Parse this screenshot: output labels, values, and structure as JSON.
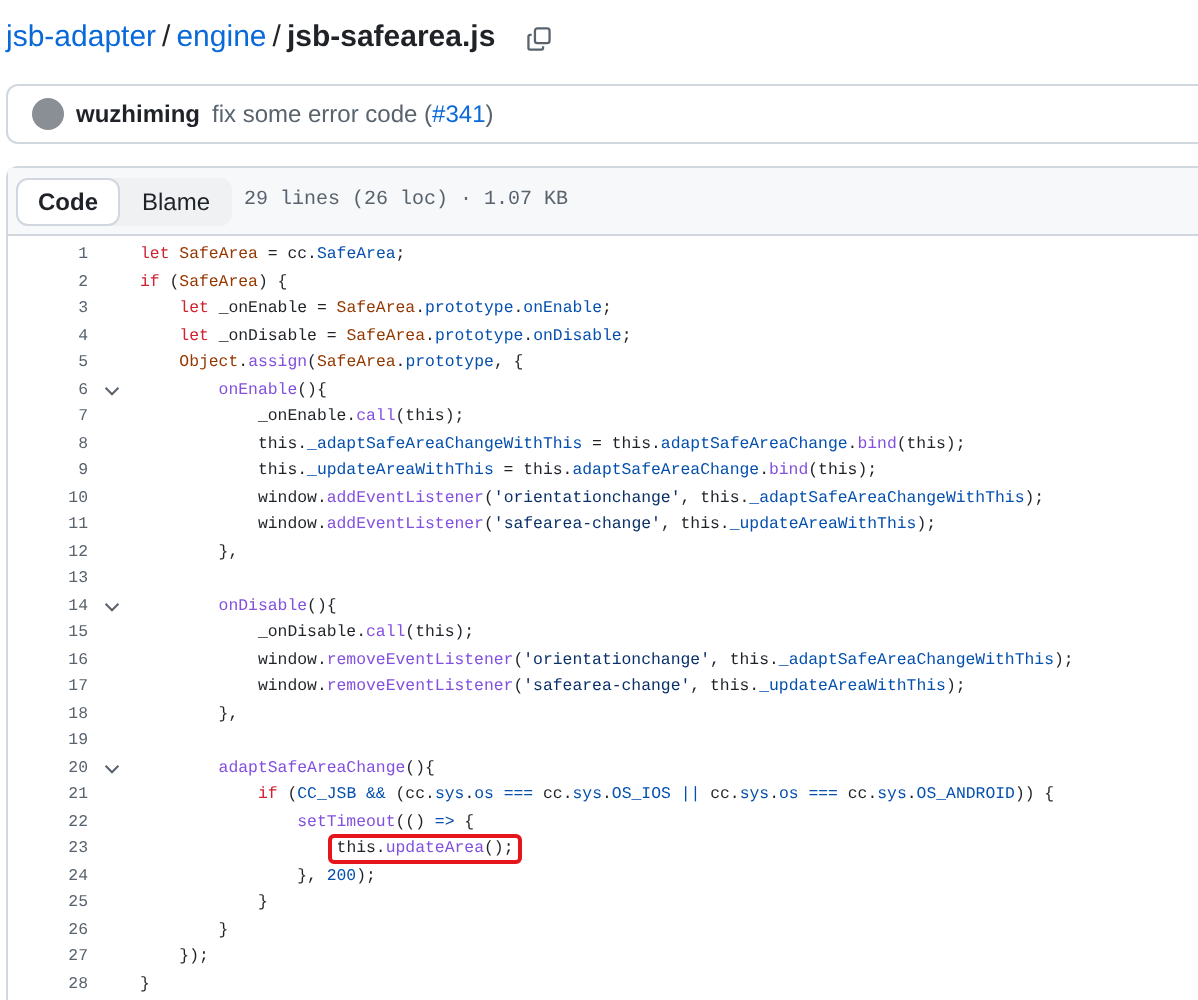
{
  "breadcrumb": {
    "links": [
      "jsb-adapter",
      "engine"
    ],
    "separator": "/",
    "current": "jsb-safearea.js"
  },
  "commit": {
    "author": "wuzhiming",
    "message": "fix some error code (",
    "pr": "#341",
    "message_end": ")"
  },
  "file_header": {
    "tabs": [
      {
        "label": "Code",
        "selected": true
      },
      {
        "label": "Blame",
        "selected": false
      }
    ],
    "info": "29 lines (26 loc) · 1.07 KB"
  },
  "code": {
    "lines": [
      {
        "number": "1",
        "foldable": false,
        "highlight": false,
        "tokens": [
          {
            "text": "let",
            "kind": "keyword"
          },
          {
            "text": " SafeArea",
            "kind": "variable"
          },
          {
            "text": " = cc.",
            "kind": "plain"
          },
          {
            "text": "SafeArea",
            "kind": "property"
          },
          {
            "text": ";",
            "kind": "plain"
          }
        ]
      },
      {
        "number": "2",
        "foldable": false,
        "highlight": false,
        "tokens": [
          {
            "text": "if",
            "kind": "keyword"
          },
          {
            "text": " (",
            "kind": "plain"
          },
          {
            "text": "SafeArea",
            "kind": "variable"
          },
          {
            "text": ") {",
            "kind": "plain"
          }
        ]
      },
      {
        "number": "3",
        "foldable": false,
        "highlight": false,
        "tokens": [
          {
            "text": "    let",
            "kind": "keyword"
          },
          {
            "text": " _onEnable = ",
            "kind": "plain"
          },
          {
            "text": "SafeArea",
            "kind": "variable"
          },
          {
            "text": ".",
            "kind": "plain"
          },
          {
            "text": "prototype",
            "kind": "property"
          },
          {
            "text": ".",
            "kind": "plain"
          },
          {
            "text": "onEnable",
            "kind": "property"
          },
          {
            "text": ";",
            "kind": "plain"
          }
        ]
      },
      {
        "number": "4",
        "foldable": false,
        "highlight": false,
        "tokens": [
          {
            "text": "    let",
            "kind": "keyword"
          },
          {
            "text": " _onDisable = ",
            "kind": "plain"
          },
          {
            "text": "SafeArea",
            "kind": "variable"
          },
          {
            "text": ".",
            "kind": "plain"
          },
          {
            "text": "prototype",
            "kind": "property"
          },
          {
            "text": ".",
            "kind": "plain"
          },
          {
            "text": "onDisable",
            "kind": "property"
          },
          {
            "text": ";",
            "kind": "plain"
          }
        ]
      },
      {
        "number": "5",
        "foldable": false,
        "highlight": false,
        "tokens": [
          {
            "text": "    Object",
            "kind": "variable"
          },
          {
            "text": ".",
            "kind": "plain"
          },
          {
            "text": "assign",
            "kind": "function"
          },
          {
            "text": "(",
            "kind": "plain"
          },
          {
            "text": "SafeArea",
            "kind": "variable"
          },
          {
            "text": ".",
            "kind": "plain"
          },
          {
            "text": "prototype",
            "kind": "property"
          },
          {
            "text": ", {",
            "kind": "plain"
          }
        ]
      },
      {
        "number": "6",
        "foldable": true,
        "highlight": false,
        "tokens": [
          {
            "text": "        onEnable",
            "kind": "function"
          },
          {
            "text": "(){",
            "kind": "plain"
          }
        ]
      },
      {
        "number": "7",
        "foldable": false,
        "highlight": false,
        "tokens": [
          {
            "text": "            _onEnable.",
            "kind": "plain"
          },
          {
            "text": "call",
            "kind": "function"
          },
          {
            "text": "(this);",
            "kind": "plain"
          }
        ]
      },
      {
        "number": "8",
        "foldable": false,
        "highlight": false,
        "tokens": [
          {
            "text": "            this.",
            "kind": "plain"
          },
          {
            "text": "_adaptSafeAreaChangeWithThis",
            "kind": "property"
          },
          {
            "text": " = this.",
            "kind": "plain"
          },
          {
            "text": "adaptSafeAreaChange",
            "kind": "property"
          },
          {
            "text": ".",
            "kind": "plain"
          },
          {
            "text": "bind",
            "kind": "function"
          },
          {
            "text": "(this);",
            "kind": "plain"
          }
        ]
      },
      {
        "number": "9",
        "foldable": false,
        "highlight": false,
        "tokens": [
          {
            "text": "            this.",
            "kind": "plain"
          },
          {
            "text": "_updateAreaWithThis",
            "kind": "property"
          },
          {
            "text": " = this.",
            "kind": "plain"
          },
          {
            "text": "adaptSafeAreaChange",
            "kind": "property"
          },
          {
            "text": ".",
            "kind": "plain"
          },
          {
            "text": "bind",
            "kind": "function"
          },
          {
            "text": "(this);",
            "kind": "plain"
          }
        ]
      },
      {
        "number": "10",
        "foldable": false,
        "highlight": false,
        "tokens": [
          {
            "text": "            window.",
            "kind": "plain"
          },
          {
            "text": "addEventListener",
            "kind": "function"
          },
          {
            "text": "(",
            "kind": "plain"
          },
          {
            "text": "'orientationchange'",
            "kind": "string"
          },
          {
            "text": ", this.",
            "kind": "plain"
          },
          {
            "text": "_adaptSafeAreaChangeWithThis",
            "kind": "property"
          },
          {
            "text": ");",
            "kind": "plain"
          }
        ]
      },
      {
        "number": "11",
        "foldable": false,
        "highlight": false,
        "tokens": [
          {
            "text": "            window.",
            "kind": "plain"
          },
          {
            "text": "addEventListener",
            "kind": "function"
          },
          {
            "text": "(",
            "kind": "plain"
          },
          {
            "text": "'safearea-change'",
            "kind": "string"
          },
          {
            "text": ", this.",
            "kind": "plain"
          },
          {
            "text": "_updateAreaWithThis",
            "kind": "property"
          },
          {
            "text": ");",
            "kind": "plain"
          }
        ]
      },
      {
        "number": "12",
        "foldable": false,
        "highlight": false,
        "tokens": [
          {
            "text": "        },",
            "kind": "plain"
          }
        ]
      },
      {
        "number": "13",
        "foldable": false,
        "highlight": false
      },
      {
        "number": "14",
        "foldable": true,
        "highlight": false,
        "tokens": [
          {
            "text": "        onDisable",
            "kind": "function"
          },
          {
            "text": "(){",
            "kind": "plain"
          }
        ]
      },
      {
        "number": "15",
        "foldable": false,
        "highlight": false,
        "tokens": [
          {
            "text": "            _onDisable.",
            "kind": "plain"
          },
          {
            "text": "call",
            "kind": "function"
          },
          {
            "text": "(this);",
            "kind": "plain"
          }
        ]
      },
      {
        "number": "16",
        "foldable": false,
        "highlight": false,
        "tokens": [
          {
            "text": "            window.",
            "kind": "plain"
          },
          {
            "text": "removeEventListener",
            "kind": "function"
          },
          {
            "text": "(",
            "kind": "plain"
          },
          {
            "text": "'orientationchange'",
            "kind": "string"
          },
          {
            "text": ", this.",
            "kind": "plain"
          },
          {
            "text": "_adaptSafeAreaChangeWithThis",
            "kind": "property"
          },
          {
            "text": ");",
            "kind": "plain"
          }
        ]
      },
      {
        "number": "17",
        "foldable": false,
        "highlight": false,
        "tokens": [
          {
            "text": "            window.",
            "kind": "plain"
          },
          {
            "text": "removeEventListener",
            "kind": "function"
          },
          {
            "text": "(",
            "kind": "plain"
          },
          {
            "text": "'safearea-change'",
            "kind": "string"
          },
          {
            "text": ", this.",
            "kind": "plain"
          },
          {
            "text": "_updateAreaWithThis",
            "kind": "property"
          },
          {
            "text": ");",
            "kind": "plain"
          }
        ]
      },
      {
        "number": "18",
        "foldable": false,
        "highlight": false,
        "tokens": [
          {
            "text": "        },",
            "kind": "plain"
          }
        ]
      },
      {
        "number": "19",
        "foldable": false,
        "highlight": false
      },
      {
        "number": "20",
        "foldable": true,
        "highlight": false,
        "tokens": [
          {
            "text": "        adaptSafeAreaChange",
            "kind": "function"
          },
          {
            "text": "(){",
            "kind": "plain"
          }
        ]
      },
      {
        "number": "21",
        "foldable": false,
        "highlight": false,
        "tokens": [
          {
            "text": "            if",
            "kind": "keyword"
          },
          {
            "text": " (",
            "kind": "plain"
          },
          {
            "text": "CC_JSB",
            "kind": "property"
          },
          {
            "text": " &&",
            "kind": "property"
          },
          {
            "text": " (cc.",
            "kind": "plain"
          },
          {
            "text": "sys",
            "kind": "property"
          },
          {
            "text": ".",
            "kind": "plain"
          },
          {
            "text": "os",
            "kind": "property"
          },
          {
            "text": " ===",
            "kind": "property"
          },
          {
            "text": " cc.",
            "kind": "plain"
          },
          {
            "text": "sys",
            "kind": "property"
          },
          {
            "text": ".",
            "kind": "plain"
          },
          {
            "text": "OS_IOS",
            "kind": "property"
          },
          {
            "text": " ||",
            "kind": "property"
          },
          {
            "text": " cc.",
            "kind": "plain"
          },
          {
            "text": "sys",
            "kind": "property"
          },
          {
            "text": ".",
            "kind": "plain"
          },
          {
            "text": "os",
            "kind": "property"
          },
          {
            "text": " ===",
            "kind": "property"
          },
          {
            "text": " cc.",
            "kind": "plain"
          },
          {
            "text": "sys",
            "kind": "property"
          },
          {
            "text": ".",
            "kind": "plain"
          },
          {
            "text": "OS_ANDROID",
            "kind": "property"
          },
          {
            "text": ")) {",
            "kind": "plain"
          }
        ]
      },
      {
        "number": "22",
        "foldable": false,
        "highlight": false,
        "tokens": [
          {
            "text": "                setTimeout",
            "kind": "function"
          },
          {
            "text": "(() ",
            "kind": "plain"
          },
          {
            "text": "=>",
            "kind": "property"
          },
          {
            "text": " {",
            "kind": "plain"
          }
        ]
      },
      {
        "number": "23",
        "foldable": false,
        "highlight": true,
        "tokens": [
          {
            "text": "                    this.",
            "kind": "plain"
          },
          {
            "text": "updateArea",
            "kind": "function"
          },
          {
            "text": "();",
            "kind": "plain"
          }
        ]
      },
      {
        "number": "24",
        "foldable": false,
        "highlight": false,
        "tokens": [
          {
            "text": "                }, ",
            "kind": "plain"
          },
          {
            "text": "200",
            "kind": "property"
          },
          {
            "text": ");",
            "kind": "plain"
          }
        ]
      },
      {
        "number": "25",
        "foldable": false,
        "highlight": false,
        "tokens": [
          {
            "text": "            }",
            "kind": "plain"
          }
        ]
      },
      {
        "number": "26",
        "foldable": false,
        "highlight": false,
        "tokens": [
          {
            "text": "        }",
            "kind": "plain"
          }
        ]
      },
      {
        "number": "27",
        "foldable": false,
        "highlight": false,
        "tokens": [
          {
            "text": "    });",
            "kind": "plain"
          }
        ]
      },
      {
        "number": "28",
        "foldable": false,
        "highlight": false,
        "tokens": [
          {
            "text": "}",
            "kind": "plain"
          }
        ]
      }
    ]
  }
}
